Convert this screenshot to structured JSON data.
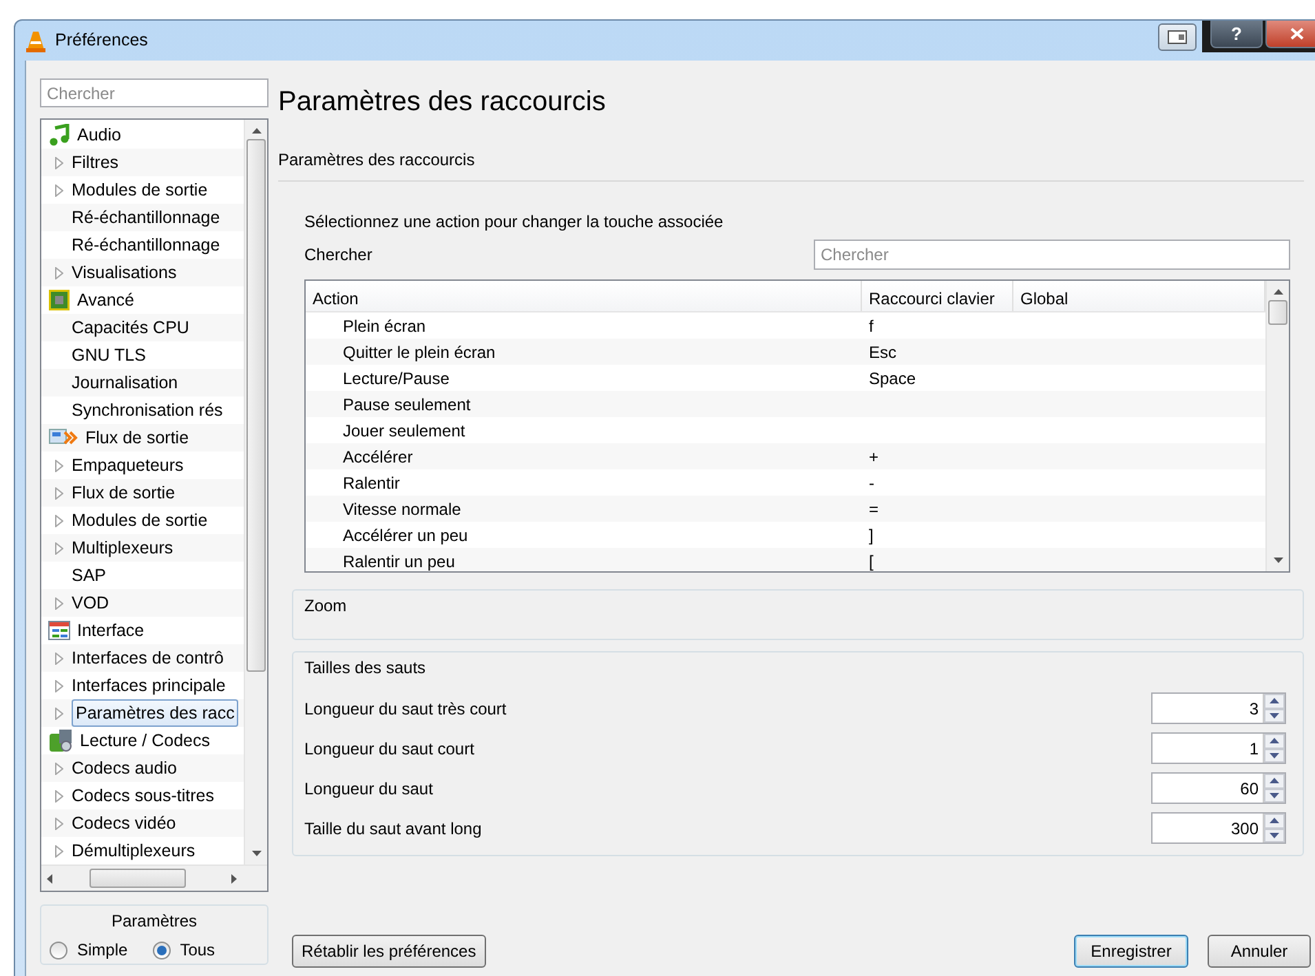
{
  "window": {
    "title": "Préférences",
    "help": "?"
  },
  "sidebar": {
    "search": {
      "placeholder": "Chercher"
    },
    "categories": [
      {
        "label": "Audio",
        "selected": false,
        "children": [
          {
            "label": "Filtres",
            "expandable": true,
            "selected": false
          },
          {
            "label": "Modules de sortie",
            "expandable": true,
            "selected": false
          },
          {
            "label": "Ré-échantillonnage",
            "expandable": false,
            "selected": false
          },
          {
            "label": "Ré-échantillonnage",
            "expandable": false,
            "selected": false
          },
          {
            "label": "Visualisations",
            "expandable": true,
            "selected": false
          }
        ]
      },
      {
        "label": "Avancé",
        "selected": false,
        "children": [
          {
            "label": "Capacités CPU",
            "expandable": false,
            "selected": false
          },
          {
            "label": "GNU TLS",
            "expandable": false,
            "selected": false
          },
          {
            "label": "Journalisation",
            "expandable": false,
            "selected": false
          },
          {
            "label": "Synchronisation rés",
            "expandable": false,
            "selected": false
          }
        ]
      },
      {
        "label": "Flux de sortie",
        "selected": false,
        "children": [
          {
            "label": "Empaqueteurs",
            "expandable": true,
            "selected": false
          },
          {
            "label": "Flux de sortie",
            "expandable": true,
            "selected": false
          },
          {
            "label": "Modules de sortie",
            "expandable": true,
            "selected": false
          },
          {
            "label": "Multiplexeurs",
            "expandable": true,
            "selected": false
          },
          {
            "label": "SAP",
            "expandable": false,
            "selected": false
          },
          {
            "label": "VOD",
            "expandable": true,
            "selected": false
          }
        ]
      },
      {
        "label": "Interface",
        "selected": false,
        "children": [
          {
            "label": "Interfaces de contrô",
            "expandable": true,
            "selected": false
          },
          {
            "label": "Interfaces principale",
            "expandable": true,
            "selected": false
          },
          {
            "label": "Paramètres des racc",
            "expandable": true,
            "selected": true
          }
        ]
      },
      {
        "label": "Lecture / Codecs",
        "selected": false,
        "children": [
          {
            "label": "Codecs audio",
            "expandable": true,
            "selected": false
          },
          {
            "label": "Codecs sous-titres",
            "expandable": true,
            "selected": false
          },
          {
            "label": "Codecs vidéo",
            "expandable": true,
            "selected": false
          },
          {
            "label": "Démultiplexeurs",
            "expandable": true,
            "selected": false
          }
        ]
      }
    ]
  },
  "mode_group": {
    "title": "Paramètres",
    "options": [
      {
        "label": "Simple",
        "selected": false
      },
      {
        "label": "Tous",
        "selected": true
      }
    ]
  },
  "panel": {
    "title": "Paramètres des raccourcis",
    "subtitle": "Paramètres des raccourcis",
    "instruction": "Sélectionnez une action pour changer la touche associée",
    "search": {
      "label": "Chercher",
      "placeholder": "Chercher"
    },
    "table": {
      "columns": [
        "Action",
        "Raccourci clavier",
        "Global"
      ],
      "rows": [
        [
          "Plein écran",
          "f",
          ""
        ],
        [
          "Quitter le plein écran",
          "Esc",
          ""
        ],
        [
          "Lecture/Pause",
          "Space",
          ""
        ],
        [
          "Pause seulement",
          "",
          ""
        ],
        [
          "Jouer seulement",
          "",
          ""
        ],
        [
          "Accélérer",
          "+",
          ""
        ],
        [
          "Ralentir",
          "-",
          ""
        ],
        [
          "Vitesse normale",
          "=",
          ""
        ],
        [
          "Accélérer un peu",
          "]",
          ""
        ],
        [
          "Ralentir un peu",
          "[",
          ""
        ]
      ]
    },
    "zoom_group": {
      "title": "Zoom"
    },
    "jump_group": {
      "title": "Tailles des sauts",
      "fields": [
        {
          "label": "Longueur du saut très court",
          "value": "3"
        },
        {
          "label": "Longueur du saut court",
          "value": "1"
        },
        {
          "label": "Longueur du saut",
          "value": "60"
        },
        {
          "label": "Taille du saut avant long",
          "value": "300"
        }
      ]
    }
  },
  "buttons": {
    "reset": "Rétablir les préférences",
    "save": "Enregistrer",
    "cancel": "Annuler"
  }
}
